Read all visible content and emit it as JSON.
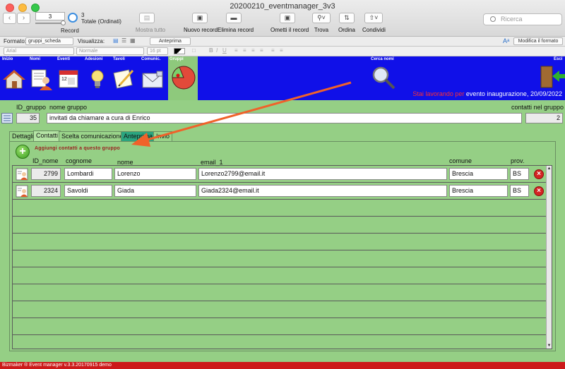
{
  "window": {
    "title": "20200210_eventmanager_3v3",
    "colors": {
      "close": "#fc605c",
      "minimize": "#fdbc40",
      "zoom": "#34c84a"
    }
  },
  "toolbar": {
    "record_value": "3",
    "record_label": "Record",
    "total_count": "3",
    "total_label": "Totale (Ordinati)",
    "show_all": "Mostra tutto",
    "new_record": "Nuovo record",
    "delete_record": "Elimina record",
    "omit_record": "Ometti il record",
    "find": "Trova",
    "sort": "Ordina",
    "share": "Condividi",
    "search_placeholder": "Ricerca"
  },
  "layoutbar": {
    "format_label": "Formato:",
    "format_value": "gruppi_scheda",
    "view_label": "Visualizza:",
    "preview_button": "Anteprima",
    "edit_format_button": "Modifica il formato"
  },
  "formatbar": {
    "font": "Arial",
    "style": "Normale",
    "size": "16 pt"
  },
  "nav": {
    "items": [
      {
        "label": "Inizio",
        "icon": "home-icon"
      },
      {
        "label": "Nomi",
        "icon": "contacts-icon"
      },
      {
        "label": "Eventi",
        "icon": "calendar-icon"
      },
      {
        "label": "Adesioni",
        "icon": "lightbulb-icon"
      },
      {
        "label": "Tavoli",
        "icon": "notepad-icon"
      },
      {
        "label": "Comunic.",
        "icon": "envelope-icon"
      },
      {
        "label": "Gruppi",
        "icon": "group-pie-icon"
      }
    ],
    "calendar_day": "12",
    "search_names": "Cerca nomi",
    "exit": "Esci",
    "status_prefix": "Stai lavorando per",
    "status_text": "evento inaugurazione, 20/09/2022",
    "colors": {
      "band": "#1010e8",
      "status_prefix": "#ff3030",
      "status_text": "#ffffff"
    }
  },
  "group": {
    "id_label": "ID_gruppo",
    "name_label": "nome gruppo",
    "contacts_label": "contatti nel gruppo",
    "id_value": "35",
    "name_value": "invitati da chiamare a cura di Enrico",
    "contacts_value": "2"
  },
  "tabs": [
    {
      "label": "Dettagli"
    },
    {
      "label": "Contatti"
    },
    {
      "label": "Scelta comunicazione"
    },
    {
      "label": "Anteprima"
    },
    {
      "label": "Invio"
    }
  ],
  "contacts": {
    "add_label": "Aggiungi contatti a questo gruppo",
    "headers": {
      "id": "ID_nome",
      "surname": "cognome",
      "name": "nome",
      "email": "email_1",
      "city": "comune",
      "province": "prov."
    },
    "rows": [
      {
        "id": "2799",
        "surname": "Lombardi",
        "name": "Lorenzo",
        "email": "Lorenzo2799@email.it",
        "city": "Brescia",
        "province": "BS"
      },
      {
        "id": "2324",
        "surname": "Savoldi",
        "name": "Giada",
        "email": "Giada2324@email.it",
        "city": "Brescia",
        "province": "BS"
      }
    ]
  },
  "footer": {
    "text": "Bizmaker ® Event manager v.3.3.20170915 demo"
  }
}
